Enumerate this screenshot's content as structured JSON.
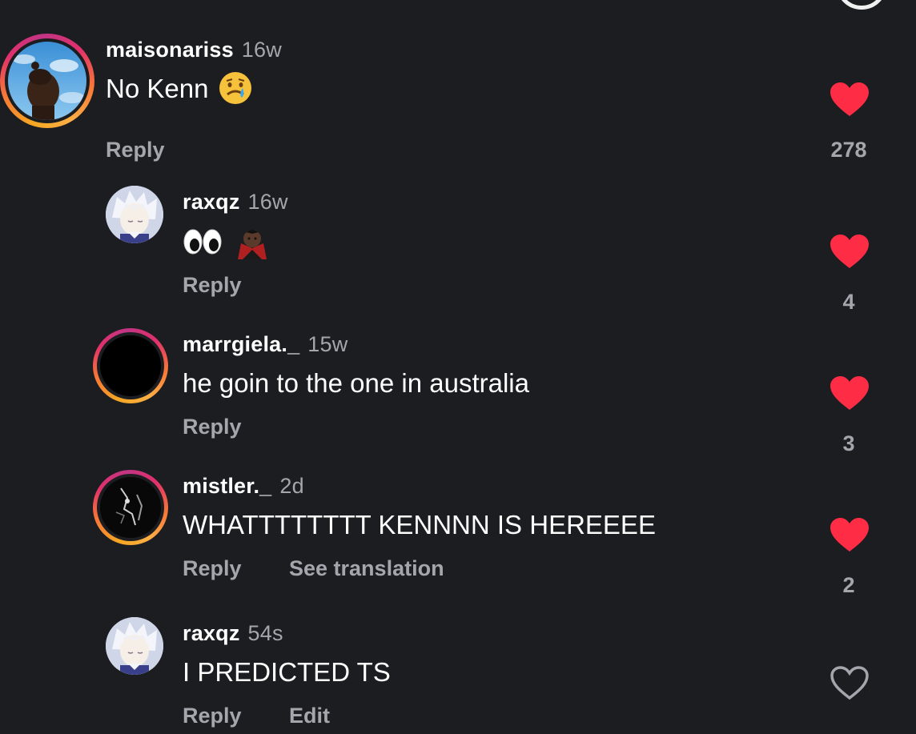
{
  "colors": {
    "background": "#1c1d21",
    "like_active": "#fe2c44",
    "muted_text": "#a4a6ad",
    "story_ring": "#e1306c"
  },
  "comments": [
    {
      "username": "maisonariss",
      "time": "16w",
      "text": "No Kenn",
      "emoji": "crying-face",
      "actions": [
        "Reply"
      ],
      "likes": "278",
      "liked": true,
      "story_ring": true
    },
    {
      "username": "raxqz",
      "time": "16w",
      "text": "",
      "emoji": "eyes + vampire",
      "actions": [
        "Reply"
      ],
      "likes": "4",
      "liked": true,
      "story_ring": false
    },
    {
      "username": "marrgiela._",
      "time": "15w",
      "text": "he goin to the one in australia",
      "actions": [
        "Reply"
      ],
      "likes": "3",
      "liked": true,
      "story_ring": true
    },
    {
      "username": "mistler._",
      "time": "2d",
      "text": "WHATTTTTTTT KENNNN IS HEREEEE",
      "actions": [
        "Reply",
        "See translation"
      ],
      "likes": "2",
      "liked": true,
      "story_ring": true
    },
    {
      "username": "raxqz",
      "time": "54s",
      "text": "I PREDICTED TS",
      "actions": [
        "Reply",
        "Edit"
      ],
      "likes": "",
      "liked": false,
      "story_ring": false
    }
  ]
}
